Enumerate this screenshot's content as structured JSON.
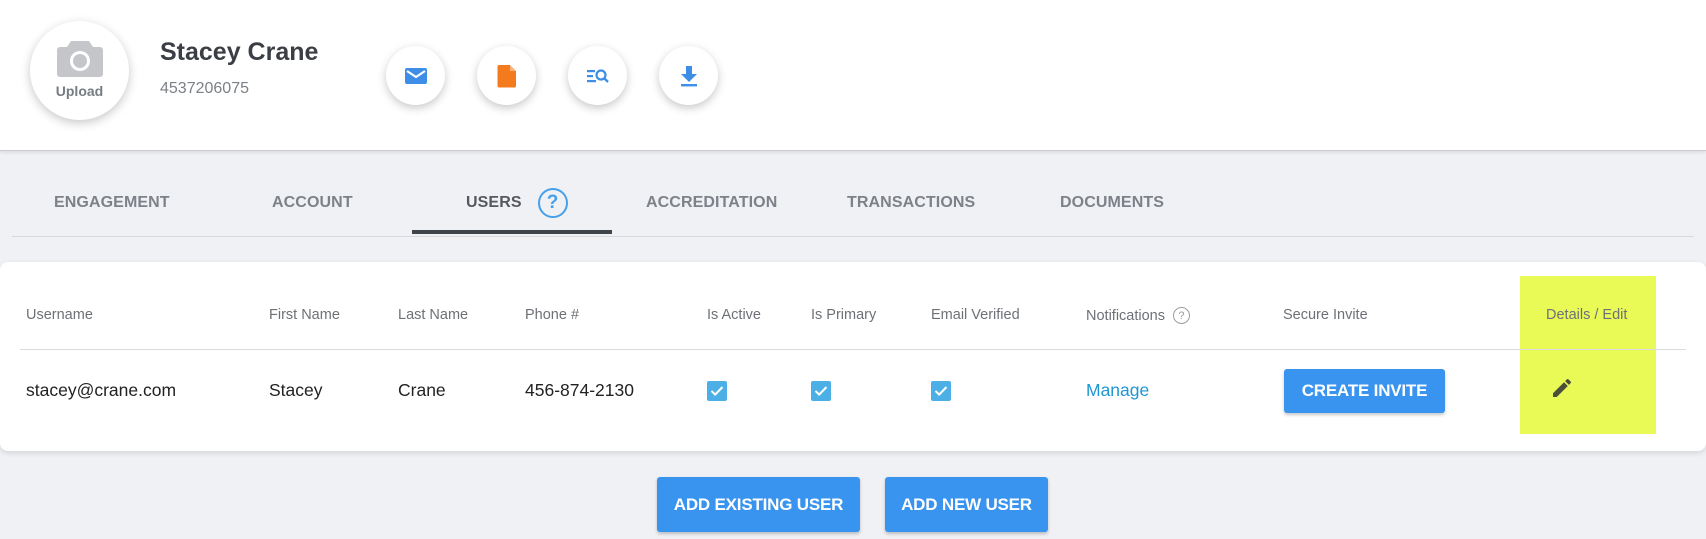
{
  "client": {
    "name": "Stacey Crane",
    "phone": "4537206075",
    "avatar_label": "Upload"
  },
  "actions": [
    {
      "icon": "mail-icon",
      "color": "#3e8ee8"
    },
    {
      "icon": "document-icon",
      "color": "#f37b1d"
    },
    {
      "icon": "search-list-icon",
      "color": "#3e8ee8"
    },
    {
      "icon": "download-icon",
      "color": "#3e8ee8"
    }
  ],
  "tabs": [
    {
      "label": "ENGAGEMENT"
    },
    {
      "label": "ACCOUNT"
    },
    {
      "label": "USERS",
      "active": true
    },
    {
      "label": "ACCREDITATION"
    },
    {
      "label": "TRANSACTIONS"
    },
    {
      "label": "DOCUMENTS"
    }
  ],
  "tab_help_symbol": "?",
  "table": {
    "headers": {
      "username": "Username",
      "first_name": "First Name",
      "last_name": "Last Name",
      "phone": "Phone #",
      "is_active": "Is Active",
      "is_primary": "Is Primary",
      "email_verified": "Email Verified",
      "notifications": "Notifications",
      "secure_invite": "Secure Invite",
      "details_edit": "Details / Edit"
    },
    "notifications_help_symbol": "?",
    "row": {
      "username": "stacey@crane.com",
      "first_name": "Stacey",
      "last_name": "Crane",
      "phone": "456-874-2130",
      "is_active": true,
      "is_primary": true,
      "email_verified": true,
      "notifications_link": "Manage",
      "invite_button": "CREATE INVITE"
    }
  },
  "footer": {
    "add_existing_label": "ADD EXISTING USER",
    "add_new_label": "ADD NEW USER"
  },
  "colors": {
    "accent": "#3994ef",
    "highlight": "#e9f956",
    "checkbox": "#4cb0e6",
    "link": "#1e96d4"
  }
}
